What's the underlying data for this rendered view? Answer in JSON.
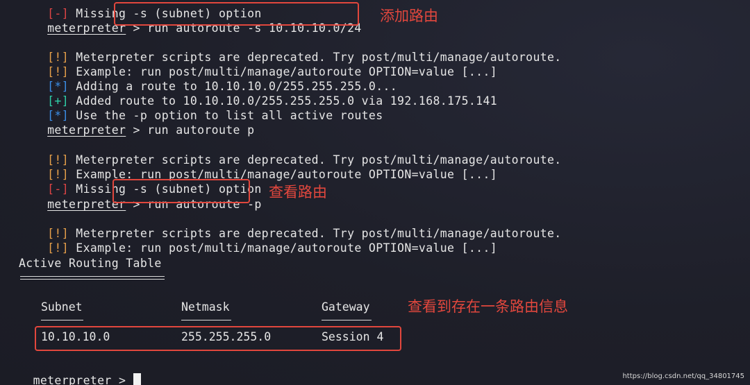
{
  "terminal": {
    "prompt": "meterpreter",
    "lines": {
      "top_partial": {
        "tag": "[-]",
        "text": " Missing -s (subnet) option"
      },
      "cmd1": " > run autoroute -s 10.10.10.0/24",
      "l1": {
        "tag": "[!]",
        "text": " Meterpreter scripts are deprecated. Try post/multi/manage/autoroute."
      },
      "l2": {
        "tag": "[!]",
        "text": " Example: run post/multi/manage/autoroute OPTION=value [...]"
      },
      "l3": {
        "tag": "[*]",
        "text": " Adding a route to 10.10.10.0/255.255.255.0..."
      },
      "l4": {
        "tag": "[+]",
        "text": " Added route to 10.10.10.0/255.255.255.0 via 192.168.175.141"
      },
      "l5": {
        "tag": "[*]",
        "text": " Use the -p option to list all active routes"
      },
      "cmd2": " > run autoroute p",
      "l6": {
        "tag": "[!]",
        "text": " Meterpreter scripts are deprecated. Try post/multi/manage/autoroute."
      },
      "l7": {
        "tag": "[!]",
        "text": " Example: run post/multi/manage/autoroute OPTION=value [...]"
      },
      "l8": {
        "tag": "[-]",
        "text": " Missing -s (subnet) option"
      },
      "cmd3": " > run autoroute -p",
      "l9": {
        "tag": "[!]",
        "text": " Meterpreter scripts are deprecated. Try post/multi/manage/autoroute."
      },
      "l10": {
        "tag": "[!]",
        "text": " Example: run post/multi/manage/autoroute OPTION=value [...]"
      },
      "table_title": "Active Routing Table",
      "final_prompt_suffix": " > "
    },
    "routing_table": {
      "headers": {
        "subnet": "Subnet",
        "netmask": "Netmask",
        "gateway": "Gateway"
      },
      "row": {
        "subnet": "10.10.10.0",
        "netmask": "255.255.255.0",
        "gateway": "Session 4"
      }
    }
  },
  "annotations": {
    "add_route": "添加路由",
    "view_route": "查看路由",
    "route_exists": "查看到存在一条路由信息"
  },
  "watermark": "https://blog.csdn.net/qq_34801745",
  "colors": {
    "warn": "#e8a14a",
    "info": "#3b8ee8",
    "ok": "#2fd1a8",
    "error": "#e04545",
    "annotation": "#e2473d"
  }
}
